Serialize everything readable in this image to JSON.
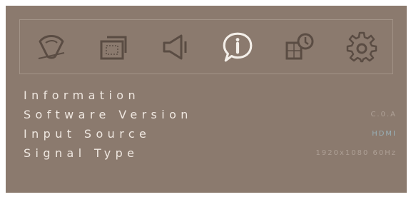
{
  "menu": {
    "tabs": [
      {
        "icon": "picture-icon"
      },
      {
        "icon": "screen-icon"
      },
      {
        "icon": "audio-icon"
      },
      {
        "icon": "information-icon",
        "selected": true
      },
      {
        "icon": "multi-window-icon"
      },
      {
        "icon": "settings-icon"
      }
    ]
  },
  "info": {
    "heading": "Information",
    "rows": [
      {
        "label": "Software Version",
        "value": "C.0.A"
      },
      {
        "label": "Input Source",
        "value": "HDMI"
      },
      {
        "label": "Signal Type",
        "value": "1920x1080 60Hz"
      }
    ]
  },
  "colors": {
    "panel": "#8b7a6e",
    "text": "#efe7e0",
    "icon_stroke": "#5a4c43",
    "icon_selected": "#f4efe9",
    "accent": "#9ec1cf"
  }
}
